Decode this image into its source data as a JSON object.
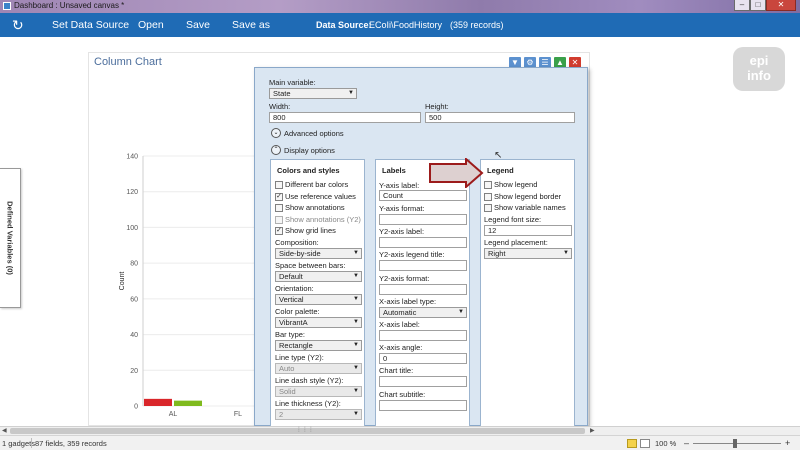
{
  "window": {
    "title": "Dashboard : Unsaved canvas *"
  },
  "toolbar": {
    "set_data_source": "Set Data Source",
    "open": "Open",
    "save": "Save",
    "save_as": "Save as",
    "data_source_label": "Data Source:",
    "data_source_value": "ECoIi\\FoodHistory",
    "record_count": "(359 records)"
  },
  "logo": {
    "line1": "epi",
    "line2": "info"
  },
  "sidebar": {
    "defined_variables": "Defined Variables (0)"
  },
  "gadget": {
    "title": "Column Chart"
  },
  "chart_data": {
    "type": "bar",
    "categories": [
      "AL",
      "FL"
    ],
    "series": [
      {
        "values": [
          4,
          0
        ],
        "color": "#d9262a"
      },
      {
        "values": [
          3,
          0
        ],
        "color": "#7fba1e"
      }
    ],
    "ylabel": "Count",
    "ylim": [
      0,
      140
    ],
    "yticks": [
      "0",
      "20",
      "40",
      "60",
      "80",
      "100",
      "120",
      "140"
    ],
    "grid": true,
    "legend": "none"
  },
  "dialog": {
    "main_variable_label": "Main variable:",
    "main_variable_value": "State",
    "width_label": "Width:",
    "width_value": "800",
    "height_label": "Height:",
    "height_value": "500",
    "advanced_options": "Advanced options",
    "display_options": "Display options",
    "colors": {
      "title": "Colors and styles",
      "different_bar_colors": "Different bar colors",
      "use_reference_values": "Use reference values",
      "show_annotations": "Show annotations",
      "show_annotations_y2": "Show annotations (Y2)",
      "show_grid_lines": "Show grid lines",
      "composition_label": "Composition:",
      "composition_value": "Side-by-side",
      "space_label": "Space between bars:",
      "space_value": "Default",
      "orientation_label": "Orientation:",
      "orientation_value": "Vertical",
      "palette_label": "Color palette:",
      "palette_value": "VibrantA",
      "bar_type_label": "Bar type:",
      "bar_type_value": "Rectangle",
      "line_type_label": "Line type (Y2):",
      "line_type_value": "Auto",
      "line_dash_label": "Line dash style (Y2):",
      "line_dash_value": "Solid",
      "line_thickness_label": "Line thickness (Y2):",
      "line_thickness_value": "2"
    },
    "labels": {
      "title": "Labels",
      "y_axis_label": "Y-axis label:",
      "y_axis_label_value": "Count",
      "y_axis_format": "Y-axis format:",
      "y2_axis_label": "Y2-axis label:",
      "y2_legend_title": "Y2-axis legend title:",
      "y2_axis_format": "Y2-axis format:",
      "x_axis_label_type": "X-axis label type:",
      "x_axis_label_type_value": "Automatic",
      "x_axis_label": "X-axis label:",
      "x_axis_angle": "X-axis angle:",
      "x_axis_angle_value": "0",
      "chart_title": "Chart title:",
      "chart_subtitle": "Chart subtitle:"
    },
    "legend": {
      "title": "Legend",
      "show_legend": "Show legend",
      "show_legend_border": "Show legend border",
      "show_variable_names": "Show variable names",
      "font_size_label": "Legend font size:",
      "font_size_value": "12",
      "placement_label": "Legend placement:",
      "placement_value": "Right"
    }
  },
  "status": {
    "gadgets": "1 gadgets",
    "fields": "87 fields, 359 records",
    "zoom": "100 %"
  }
}
